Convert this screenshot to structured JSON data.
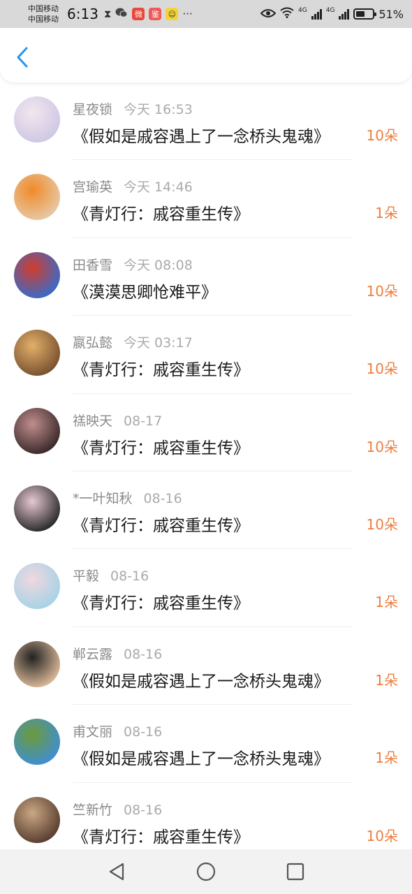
{
  "status_bar": {
    "carrier1": "中国移动",
    "carrier2": "中国移动",
    "time": "6:13",
    "battery": "51%",
    "battery_level": 0.51,
    "network1": "4G",
    "network2": "4G"
  },
  "colors": {
    "accent": "#2196f3",
    "count": "#ef7d3c",
    "meta": "#8a8a8a"
  },
  "items": [
    {
      "name": "星夜锁",
      "time": "今天 16:53",
      "title": "《假如是戚容遇上了一念桥头鬼魂》",
      "count": "10朵",
      "avatar_colors": [
        "#cfc8e4",
        "#f2e6ee"
      ]
    },
    {
      "name": "宫瑜英",
      "time": "今天 14:46",
      "title": "《青灯行：戚容重生传》",
      "count": "1朵",
      "avatar_colors": [
        "#e7c7a4",
        "#f08a28"
      ]
    },
    {
      "name": "田香雪",
      "time": "今天 08:08",
      "title": "《漠漠思卿怆难平》",
      "count": "10朵",
      "avatar_colors": [
        "#3a6ac8",
        "#d23c2c"
      ]
    },
    {
      "name": "嬴弘懿",
      "time": "今天 03:17",
      "title": "《青灯行：戚容重生传》",
      "count": "10朵",
      "avatar_colors": [
        "#7a5230",
        "#e2b06a"
      ]
    },
    {
      "name": "禚映天",
      "time": "08-17",
      "title": "《青灯行：戚容重生传》",
      "count": "10朵",
      "avatar_colors": [
        "#3c2a2a",
        "#c08e8e"
      ]
    },
    {
      "name": "*一叶知秋",
      "time": "08-16",
      "title": "《青灯行：戚容重生传》",
      "count": "10朵",
      "avatar_colors": [
        "#2c2c2c",
        "#e7c8d2"
      ]
    },
    {
      "name": "平毅",
      "time": "08-16",
      "title": "《青灯行：戚容重生传》",
      "count": "1朵",
      "avatar_colors": [
        "#a7d2e6",
        "#f0d8e0"
      ]
    },
    {
      "name": "郸云露",
      "time": "08-16",
      "title": "《假如是戚容遇上了一念桥头鬼魂》",
      "count": "1朵",
      "avatar_colors": [
        "#d8b796",
        "#222222"
      ]
    },
    {
      "name": "甫文丽",
      "time": "08-16",
      "title": "《假如是戚容遇上了一念桥头鬼魂》",
      "count": "1朵",
      "avatar_colors": [
        "#3f8fd0",
        "#6e9a3a"
      ]
    },
    {
      "name": "竺新竹",
      "time": "08-16",
      "title": "《青灯行：戚容重生传》",
      "count": "10朵",
      "avatar_colors": [
        "#5a3e30",
        "#c9a884"
      ]
    }
  ]
}
